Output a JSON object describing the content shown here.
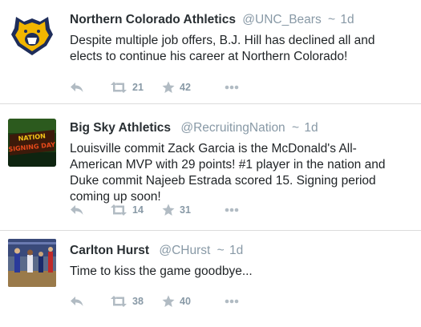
{
  "tweets": [
    {
      "name": "Northern Colorado Athletics",
      "handle": "@UNC_Bears",
      "separator": "~",
      "time": "1d",
      "text": "Despite multiple job offers, B.J. Hill has declined all and elects to continue his career at Northern Colorado!",
      "retweets": "21",
      "likes": "42"
    },
    {
      "name": "Big Sky Athletics",
      "handle": "@RecruitingNation",
      "separator": "~",
      "time": "1d",
      "text": "Louisville commit Zack Garcia is the McDonald's All-American MVP with 29 points! #1 player in the nation and Duke commit Najeeb Estrada scored 15. Signing period coming up soon!",
      "retweets": "14",
      "likes": "31",
      "avatar_text": "NATION SIGNING DAY"
    },
    {
      "name": "Carlton Hurst",
      "handle": "@CHurst",
      "separator": "~",
      "time": "1d",
      "text": "Time to kiss the game goodbye...",
      "retweets": "38",
      "likes": "40"
    }
  ],
  "icons": {
    "reply": "reply-icon",
    "retweet": "retweet-icon",
    "like": "star-icon",
    "more": "more-icon"
  },
  "colors": {
    "name": "#292f33",
    "meta": "#8899a6",
    "icon": "#b1bbc3",
    "divider": "#dcdcdc",
    "unc_navy": "#1e2d5a",
    "unc_gold": "#f2b600"
  }
}
